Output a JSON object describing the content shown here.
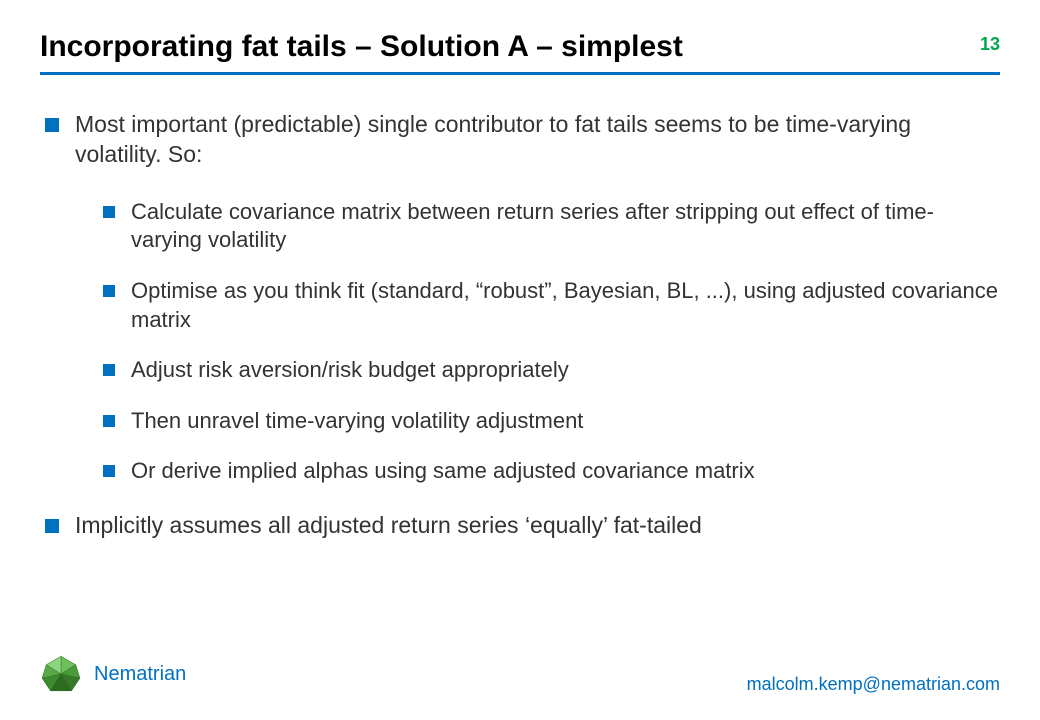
{
  "header": {
    "title": "Incorporating fat tails – Solution A – simplest",
    "page_number": "13"
  },
  "content": {
    "bullets_l1_a": "Most important (predictable) single contributor to fat tails seems to be time-varying volatility. So:",
    "sub_bullets": [
      "Calculate covariance matrix between return series after stripping out effect of time-varying volatility",
      "Optimise as you think fit (standard, “robust”, Bayesian, BL, ...), using adjusted covariance matrix",
      "Adjust risk aversion/risk budget appropriately",
      "Then unravel time-varying volatility adjustment",
      "Or derive implied alphas using same adjusted covariance matrix"
    ],
    "bullets_l1_b": "Implicitly assumes all adjusted return series ‘equally’ fat-tailed"
  },
  "footer": {
    "brand": "Nematrian",
    "email": "malcolm.kemp@nematrian.com"
  }
}
